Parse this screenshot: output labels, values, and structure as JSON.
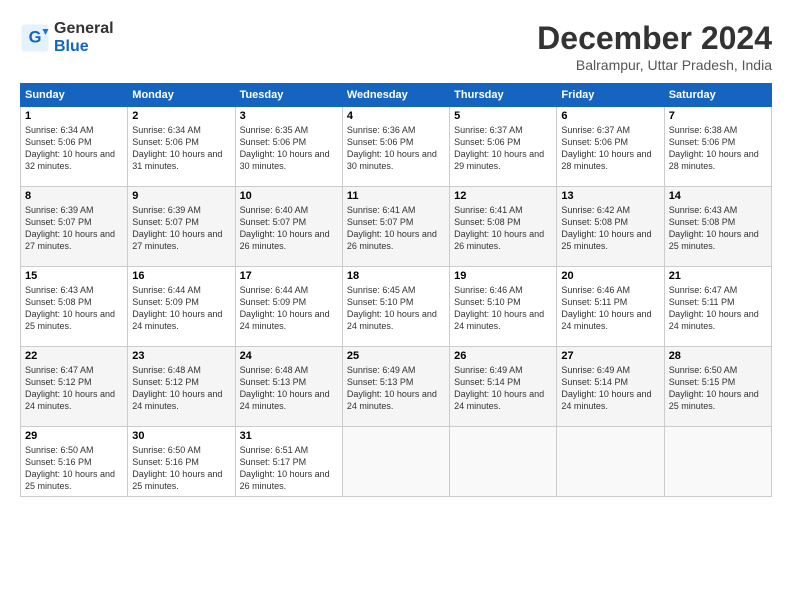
{
  "logo": {
    "general": "General",
    "blue": "Blue"
  },
  "title": "December 2024",
  "location": "Balrampur, Uttar Pradesh, India",
  "weekdays": [
    "Sunday",
    "Monday",
    "Tuesday",
    "Wednesday",
    "Thursday",
    "Friday",
    "Saturday"
  ],
  "weeks": [
    [
      {
        "day": "1",
        "sunrise": "6:34 AM",
        "sunset": "5:06 PM",
        "daylight": "10 hours and 32 minutes."
      },
      {
        "day": "2",
        "sunrise": "6:34 AM",
        "sunset": "5:06 PM",
        "daylight": "10 hours and 31 minutes."
      },
      {
        "day": "3",
        "sunrise": "6:35 AM",
        "sunset": "5:06 PM",
        "daylight": "10 hours and 30 minutes."
      },
      {
        "day": "4",
        "sunrise": "6:36 AM",
        "sunset": "5:06 PM",
        "daylight": "10 hours and 30 minutes."
      },
      {
        "day": "5",
        "sunrise": "6:37 AM",
        "sunset": "5:06 PM",
        "daylight": "10 hours and 29 minutes."
      },
      {
        "day": "6",
        "sunrise": "6:37 AM",
        "sunset": "5:06 PM",
        "daylight": "10 hours and 28 minutes."
      },
      {
        "day": "7",
        "sunrise": "6:38 AM",
        "sunset": "5:06 PM",
        "daylight": "10 hours and 28 minutes."
      }
    ],
    [
      {
        "day": "8",
        "sunrise": "6:39 AM",
        "sunset": "5:07 PM",
        "daylight": "10 hours and 27 minutes."
      },
      {
        "day": "9",
        "sunrise": "6:39 AM",
        "sunset": "5:07 PM",
        "daylight": "10 hours and 27 minutes."
      },
      {
        "day": "10",
        "sunrise": "6:40 AM",
        "sunset": "5:07 PM",
        "daylight": "10 hours and 26 minutes."
      },
      {
        "day": "11",
        "sunrise": "6:41 AM",
        "sunset": "5:07 PM",
        "daylight": "10 hours and 26 minutes."
      },
      {
        "day": "12",
        "sunrise": "6:41 AM",
        "sunset": "5:08 PM",
        "daylight": "10 hours and 26 minutes."
      },
      {
        "day": "13",
        "sunrise": "6:42 AM",
        "sunset": "5:08 PM",
        "daylight": "10 hours and 25 minutes."
      },
      {
        "day": "14",
        "sunrise": "6:43 AM",
        "sunset": "5:08 PM",
        "daylight": "10 hours and 25 minutes."
      }
    ],
    [
      {
        "day": "15",
        "sunrise": "6:43 AM",
        "sunset": "5:08 PM",
        "daylight": "10 hours and 25 minutes."
      },
      {
        "day": "16",
        "sunrise": "6:44 AM",
        "sunset": "5:09 PM",
        "daylight": "10 hours and 24 minutes."
      },
      {
        "day": "17",
        "sunrise": "6:44 AM",
        "sunset": "5:09 PM",
        "daylight": "10 hours and 24 minutes."
      },
      {
        "day": "18",
        "sunrise": "6:45 AM",
        "sunset": "5:10 PM",
        "daylight": "10 hours and 24 minutes."
      },
      {
        "day": "19",
        "sunrise": "6:46 AM",
        "sunset": "5:10 PM",
        "daylight": "10 hours and 24 minutes."
      },
      {
        "day": "20",
        "sunrise": "6:46 AM",
        "sunset": "5:11 PM",
        "daylight": "10 hours and 24 minutes."
      },
      {
        "day": "21",
        "sunrise": "6:47 AM",
        "sunset": "5:11 PM",
        "daylight": "10 hours and 24 minutes."
      }
    ],
    [
      {
        "day": "22",
        "sunrise": "6:47 AM",
        "sunset": "5:12 PM",
        "daylight": "10 hours and 24 minutes."
      },
      {
        "day": "23",
        "sunrise": "6:48 AM",
        "sunset": "5:12 PM",
        "daylight": "10 hours and 24 minutes."
      },
      {
        "day": "24",
        "sunrise": "6:48 AM",
        "sunset": "5:13 PM",
        "daylight": "10 hours and 24 minutes."
      },
      {
        "day": "25",
        "sunrise": "6:49 AM",
        "sunset": "5:13 PM",
        "daylight": "10 hours and 24 minutes."
      },
      {
        "day": "26",
        "sunrise": "6:49 AM",
        "sunset": "5:14 PM",
        "daylight": "10 hours and 24 minutes."
      },
      {
        "day": "27",
        "sunrise": "6:49 AM",
        "sunset": "5:14 PM",
        "daylight": "10 hours and 24 minutes."
      },
      {
        "day": "28",
        "sunrise": "6:50 AM",
        "sunset": "5:15 PM",
        "daylight": "10 hours and 25 minutes."
      }
    ],
    [
      {
        "day": "29",
        "sunrise": "6:50 AM",
        "sunset": "5:16 PM",
        "daylight": "10 hours and 25 minutes."
      },
      {
        "day": "30",
        "sunrise": "6:50 AM",
        "sunset": "5:16 PM",
        "daylight": "10 hours and 25 minutes."
      },
      {
        "day": "31",
        "sunrise": "6:51 AM",
        "sunset": "5:17 PM",
        "daylight": "10 hours and 26 minutes."
      },
      null,
      null,
      null,
      null
    ]
  ]
}
